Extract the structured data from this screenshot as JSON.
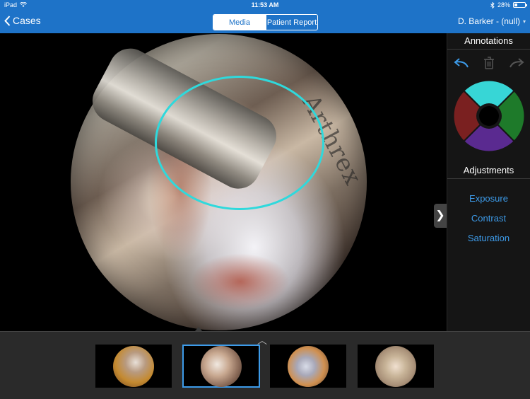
{
  "status_bar": {
    "device": "iPad",
    "time": "11:53 AM",
    "battery": "28%"
  },
  "nav": {
    "back_label": "Cases",
    "segments": [
      {
        "label": "Media",
        "active": true
      },
      {
        "label": "Patient Report",
        "active": false
      }
    ],
    "user_label": "D. Barker - (null)"
  },
  "image": {
    "instrument_engraving": "Arthrex"
  },
  "annotations": {
    "title": "Annotations",
    "tools": [
      {
        "name": "undo-icon",
        "enabled": true
      },
      {
        "name": "trash-icon",
        "enabled": false
      },
      {
        "name": "redo-icon",
        "enabled": false
      }
    ],
    "colors": [
      {
        "name": "cyan",
        "hex": "#37d6d6"
      },
      {
        "name": "green",
        "hex": "#1e7a2a"
      },
      {
        "name": "purple",
        "hex": "#5a2a90"
      },
      {
        "name": "red",
        "hex": "#7a2020"
      }
    ],
    "selected_color": "#37d6d6"
  },
  "adjustments": {
    "title": "Adjustments",
    "items": [
      "Exposure",
      "Contrast",
      "Saturation"
    ]
  },
  "thumbnails": {
    "selected_index": 1,
    "count": 4
  },
  "colors": {
    "accent": "#1e73c8",
    "link": "#3d9be9",
    "annotation_stroke": "#2fd9dc"
  }
}
